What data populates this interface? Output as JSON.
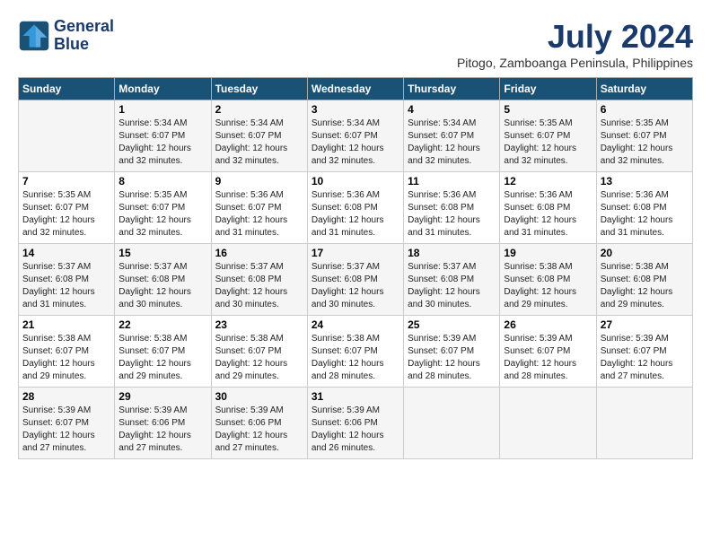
{
  "logo": {
    "line1": "General",
    "line2": "Blue"
  },
  "title": "July 2024",
  "subtitle": "Pitogo, Zamboanga Peninsula, Philippines",
  "days_header": [
    "Sunday",
    "Monday",
    "Tuesday",
    "Wednesday",
    "Thursday",
    "Friday",
    "Saturday"
  ],
  "weeks": [
    [
      {
        "day": "",
        "info": ""
      },
      {
        "day": "1",
        "info": "Sunrise: 5:34 AM\nSunset: 6:07 PM\nDaylight: 12 hours\nand 32 minutes."
      },
      {
        "day": "2",
        "info": "Sunrise: 5:34 AM\nSunset: 6:07 PM\nDaylight: 12 hours\nand 32 minutes."
      },
      {
        "day": "3",
        "info": "Sunrise: 5:34 AM\nSunset: 6:07 PM\nDaylight: 12 hours\nand 32 minutes."
      },
      {
        "day": "4",
        "info": "Sunrise: 5:34 AM\nSunset: 6:07 PM\nDaylight: 12 hours\nand 32 minutes."
      },
      {
        "day": "5",
        "info": "Sunrise: 5:35 AM\nSunset: 6:07 PM\nDaylight: 12 hours\nand 32 minutes."
      },
      {
        "day": "6",
        "info": "Sunrise: 5:35 AM\nSunset: 6:07 PM\nDaylight: 12 hours\nand 32 minutes."
      }
    ],
    [
      {
        "day": "7",
        "info": "Sunrise: 5:35 AM\nSunset: 6:07 PM\nDaylight: 12 hours\nand 32 minutes."
      },
      {
        "day": "8",
        "info": "Sunrise: 5:35 AM\nSunset: 6:07 PM\nDaylight: 12 hours\nand 32 minutes."
      },
      {
        "day": "9",
        "info": "Sunrise: 5:36 AM\nSunset: 6:07 PM\nDaylight: 12 hours\nand 31 minutes."
      },
      {
        "day": "10",
        "info": "Sunrise: 5:36 AM\nSunset: 6:08 PM\nDaylight: 12 hours\nand 31 minutes."
      },
      {
        "day": "11",
        "info": "Sunrise: 5:36 AM\nSunset: 6:08 PM\nDaylight: 12 hours\nand 31 minutes."
      },
      {
        "day": "12",
        "info": "Sunrise: 5:36 AM\nSunset: 6:08 PM\nDaylight: 12 hours\nand 31 minutes."
      },
      {
        "day": "13",
        "info": "Sunrise: 5:36 AM\nSunset: 6:08 PM\nDaylight: 12 hours\nand 31 minutes."
      }
    ],
    [
      {
        "day": "14",
        "info": "Sunrise: 5:37 AM\nSunset: 6:08 PM\nDaylight: 12 hours\nand 31 minutes."
      },
      {
        "day": "15",
        "info": "Sunrise: 5:37 AM\nSunset: 6:08 PM\nDaylight: 12 hours\nand 30 minutes."
      },
      {
        "day": "16",
        "info": "Sunrise: 5:37 AM\nSunset: 6:08 PM\nDaylight: 12 hours\nand 30 minutes."
      },
      {
        "day": "17",
        "info": "Sunrise: 5:37 AM\nSunset: 6:08 PM\nDaylight: 12 hours\nand 30 minutes."
      },
      {
        "day": "18",
        "info": "Sunrise: 5:37 AM\nSunset: 6:08 PM\nDaylight: 12 hours\nand 30 minutes."
      },
      {
        "day": "19",
        "info": "Sunrise: 5:38 AM\nSunset: 6:08 PM\nDaylight: 12 hours\nand 29 minutes."
      },
      {
        "day": "20",
        "info": "Sunrise: 5:38 AM\nSunset: 6:08 PM\nDaylight: 12 hours\nand 29 minutes."
      }
    ],
    [
      {
        "day": "21",
        "info": "Sunrise: 5:38 AM\nSunset: 6:07 PM\nDaylight: 12 hours\nand 29 minutes."
      },
      {
        "day": "22",
        "info": "Sunrise: 5:38 AM\nSunset: 6:07 PM\nDaylight: 12 hours\nand 29 minutes."
      },
      {
        "day": "23",
        "info": "Sunrise: 5:38 AM\nSunset: 6:07 PM\nDaylight: 12 hours\nand 29 minutes."
      },
      {
        "day": "24",
        "info": "Sunrise: 5:38 AM\nSunset: 6:07 PM\nDaylight: 12 hours\nand 28 minutes."
      },
      {
        "day": "25",
        "info": "Sunrise: 5:39 AM\nSunset: 6:07 PM\nDaylight: 12 hours\nand 28 minutes."
      },
      {
        "day": "26",
        "info": "Sunrise: 5:39 AM\nSunset: 6:07 PM\nDaylight: 12 hours\nand 28 minutes."
      },
      {
        "day": "27",
        "info": "Sunrise: 5:39 AM\nSunset: 6:07 PM\nDaylight: 12 hours\nand 27 minutes."
      }
    ],
    [
      {
        "day": "28",
        "info": "Sunrise: 5:39 AM\nSunset: 6:07 PM\nDaylight: 12 hours\nand 27 minutes."
      },
      {
        "day": "29",
        "info": "Sunrise: 5:39 AM\nSunset: 6:06 PM\nDaylight: 12 hours\nand 27 minutes."
      },
      {
        "day": "30",
        "info": "Sunrise: 5:39 AM\nSunset: 6:06 PM\nDaylight: 12 hours\nand 27 minutes."
      },
      {
        "day": "31",
        "info": "Sunrise: 5:39 AM\nSunset: 6:06 PM\nDaylight: 12 hours\nand 26 minutes."
      },
      {
        "day": "",
        "info": ""
      },
      {
        "day": "",
        "info": ""
      },
      {
        "day": "",
        "info": ""
      }
    ]
  ]
}
